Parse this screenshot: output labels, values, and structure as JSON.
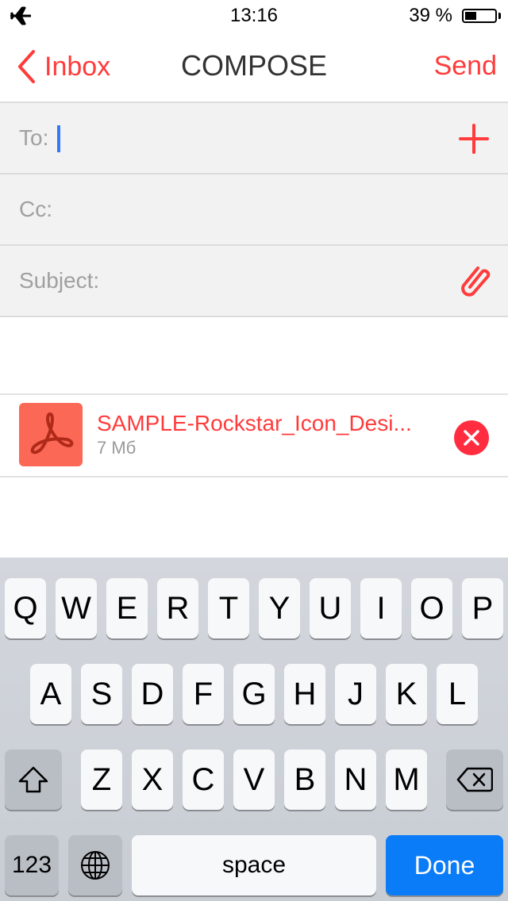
{
  "status_bar": {
    "left_icon": "airplane-icon",
    "time": "13:16",
    "battery_text": "39 %",
    "battery_level": 0.39
  },
  "nav": {
    "back_label": "Inbox",
    "back_icon": "chevron-left-icon",
    "title": "COMPOSE",
    "send_label": "Send"
  },
  "fields": {
    "to_label": "To:",
    "to_value": "",
    "cc_label": "Cc:",
    "cc_value": "",
    "subject_label": "Subject:",
    "subject_value": "",
    "add_icon": "plus-icon",
    "attach_icon": "paperclip-icon"
  },
  "attachment": {
    "icon": "pdf-icon",
    "name": "SAMPLE-Rockstar_Icon_Desi...",
    "size": "7 Мб",
    "remove_icon": "close-circle-icon"
  },
  "keyboard": {
    "row1": [
      "Q",
      "W",
      "E",
      "R",
      "T",
      "Y",
      "U",
      "I",
      "O",
      "P"
    ],
    "row2": [
      "A",
      "S",
      "D",
      "F",
      "G",
      "H",
      "J",
      "K",
      "L"
    ],
    "row3": [
      "Z",
      "X",
      "C",
      "V",
      "B",
      "N",
      "M"
    ],
    "shift_icon": "shift-icon",
    "backspace_icon": "backspace-icon",
    "numbers_label": "123",
    "globe_icon": "globe-icon",
    "space_label": "space",
    "done_label": "Done"
  },
  "colors": {
    "accent": "#ff3b3b",
    "cursor": "#3478f6",
    "done_key": "#0a7cf8",
    "pdf_tile": "#fc6856"
  }
}
